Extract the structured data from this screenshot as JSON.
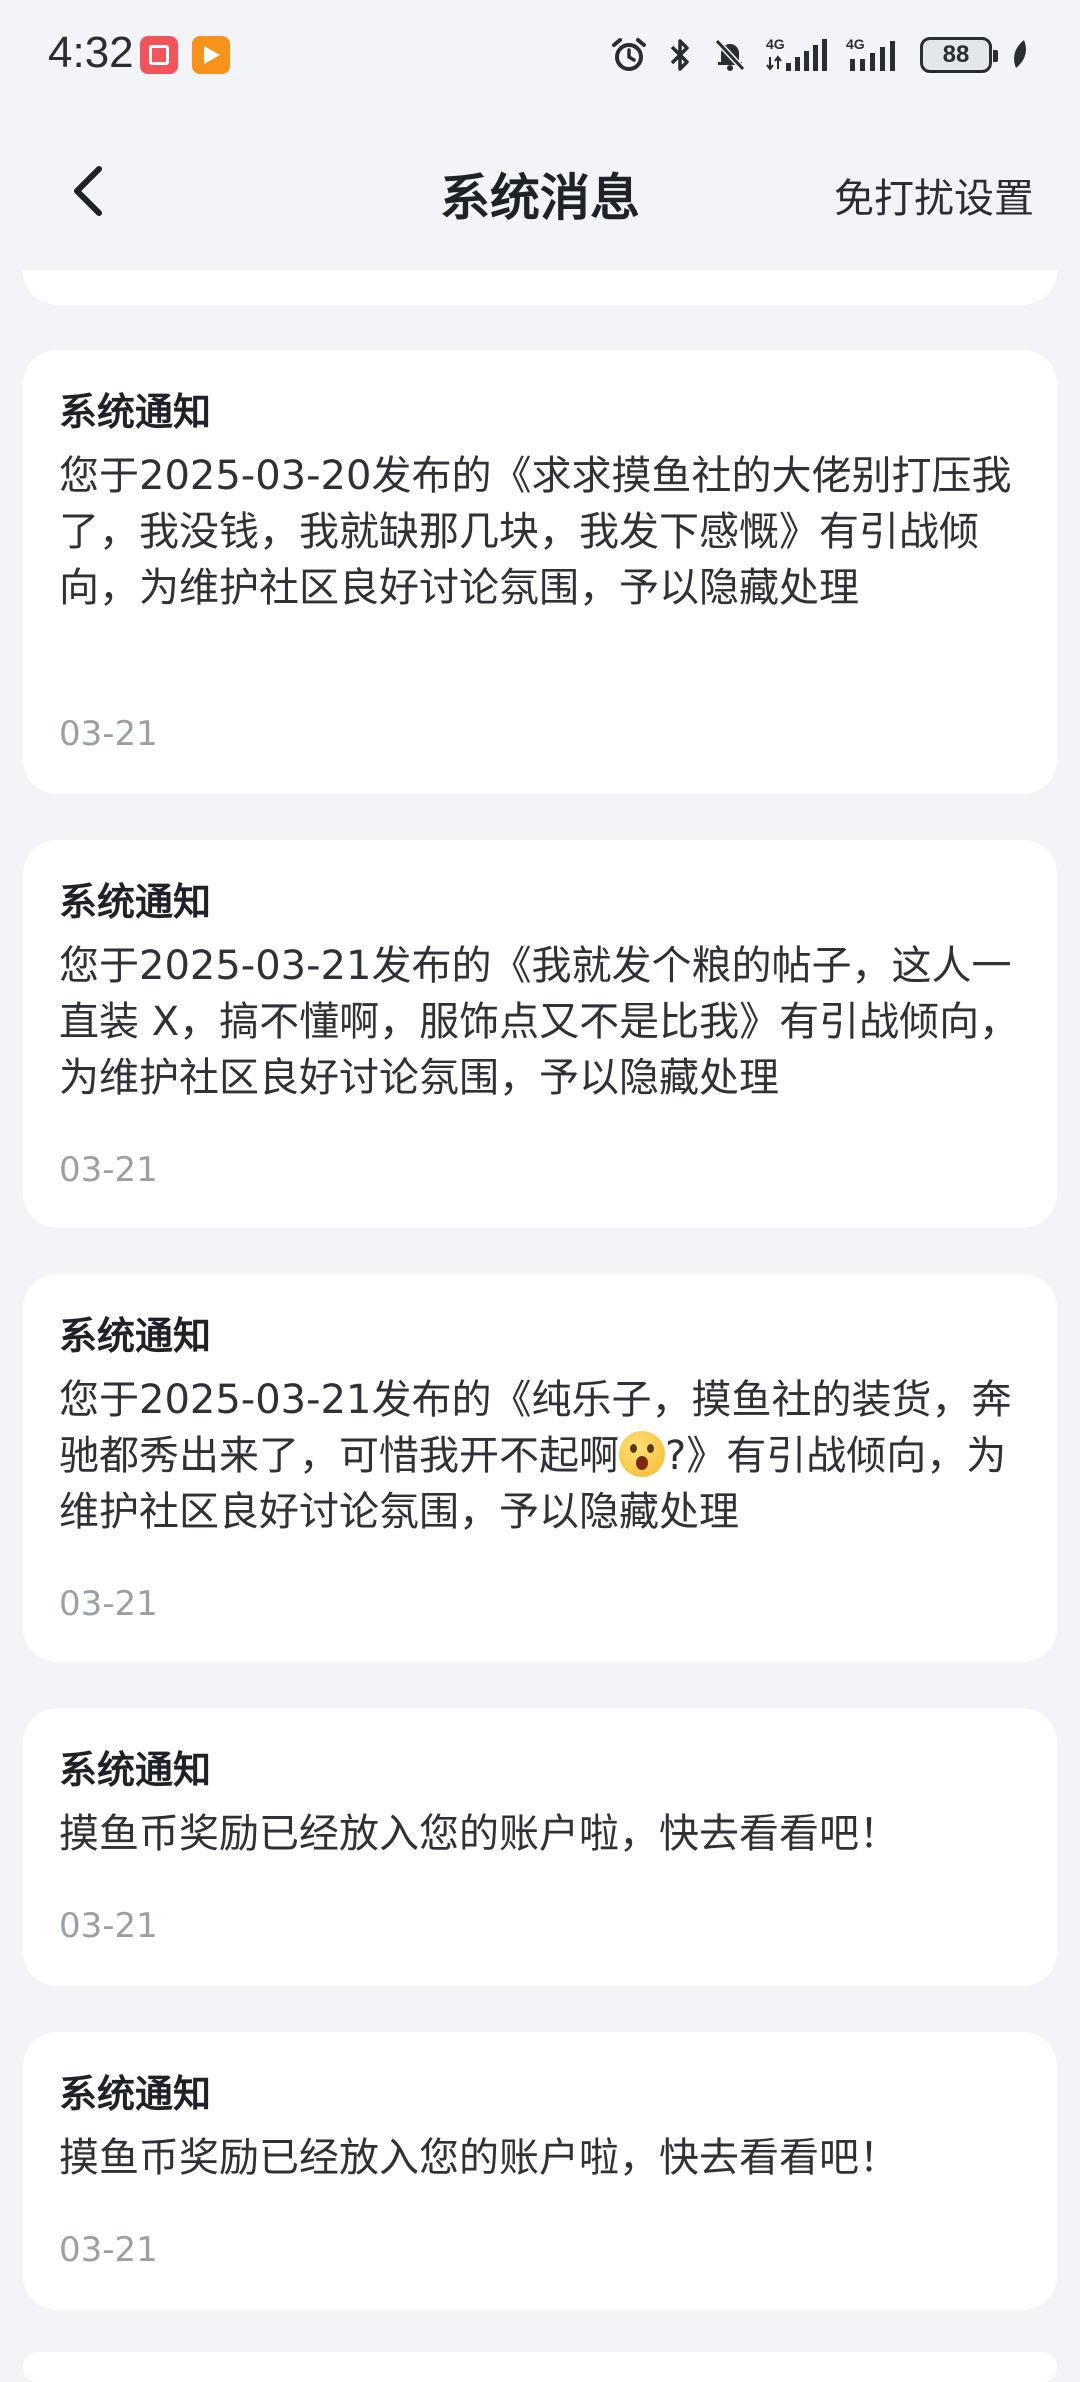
{
  "status_bar": {
    "time": "4:32",
    "network_1": "4G",
    "network_2": "4G",
    "battery": "88"
  },
  "header": {
    "title": "系统消息",
    "dnd_label": "免打扰设置"
  },
  "notifications": [
    {
      "title": "系统通知",
      "body": "您于2025-03-20发布的《求求摸鱼社的大佬别打压我了，我没钱，我就缺那几块，我发下感慨》有引战倾向，为维护社区良好讨论氛围，予以隐藏处理",
      "date": "03-21"
    },
    {
      "title": "系统通知",
      "body": "您于2025-03-21发布的《我就发个粮的帖子，这人一直装 X，搞不懂啊，服饰点又不是比我》有引战倾向，为维护社区良好讨论氛围，予以隐藏处理",
      "date": "03-21"
    },
    {
      "title": "系统通知",
      "body_before_emoji": "您于2025-03-21发布的《纯乐子，摸鱼社的装货，奔驰都秀出来了，可惜我开不起啊",
      "body_after_emoji": "?》有引战倾向，为维护社区良好讨论氛围，予以隐藏处理",
      "date": "03-21"
    },
    {
      "title": "系统通知",
      "body": "摸鱼币奖励已经放入您的账户啦，快去看看吧！",
      "date": "03-21"
    },
    {
      "title": "系统通知",
      "body": "摸鱼币奖励已经放入您的账户啦，快去看看吧！",
      "date": "03-21"
    }
  ]
}
